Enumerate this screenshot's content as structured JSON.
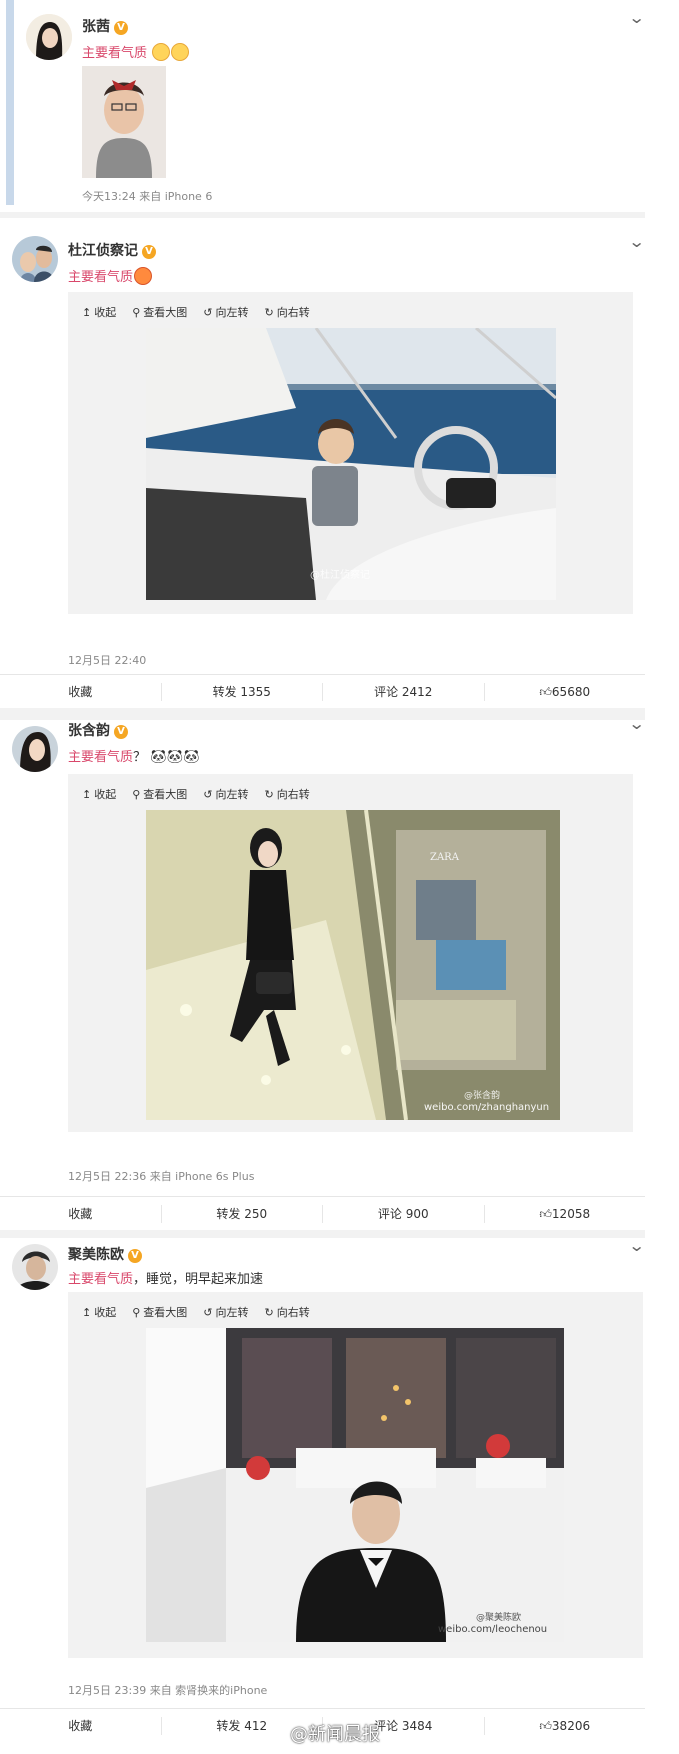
{
  "posts": [
    {
      "name": "张茜",
      "text_highlight": "主要看气质",
      "meta": "今天13:24 来自 iPhone 6"
    },
    {
      "name": "杜江侦察记",
      "text_highlight": "主要看气质",
      "toolbar": [
        "收起",
        "查看大图",
        "向左转",
        "向右转"
      ],
      "watermark": "@杜江侦察记",
      "meta": "12月5日 22:40",
      "actions": [
        "收藏",
        "转发 1355",
        "评论 2412",
        "65680"
      ]
    },
    {
      "name": "张含韵",
      "text_highlight": "主要看气质",
      "text_rest": "？",
      "toolbar": [
        "收起",
        "查看大图",
        "向左转",
        "向右转"
      ],
      "photo_sign": "ZARA",
      "watermark": "@张含韵",
      "watermark2": "weibo.com/zhanghanyun",
      "meta": "12月5日 22:36 来自 iPhone 6s Plus",
      "actions": [
        "收藏",
        "转发 250",
        "评论 900",
        "12058"
      ]
    },
    {
      "name": "聚美陈欧",
      "text_highlight": "主要看气质",
      "text_rest": "，睡觉，明早起来加速",
      "toolbar": [
        "收起",
        "查看大图",
        "向左转",
        "向右转"
      ],
      "watermark": "@聚美陈欧",
      "watermark2": "weibo.com/leochenou",
      "meta": "12月5日 23:39 来自 索肾换来的iPhone",
      "actions": [
        "收藏",
        "转发 412",
        "评论 3484",
        "38206"
      ]
    }
  ],
  "footer_watermark": "@新闻晨报",
  "colors": {
    "highlight": "#d9486b",
    "vbadge": "#f5a623",
    "expand_bg": "#f2f2f2"
  }
}
